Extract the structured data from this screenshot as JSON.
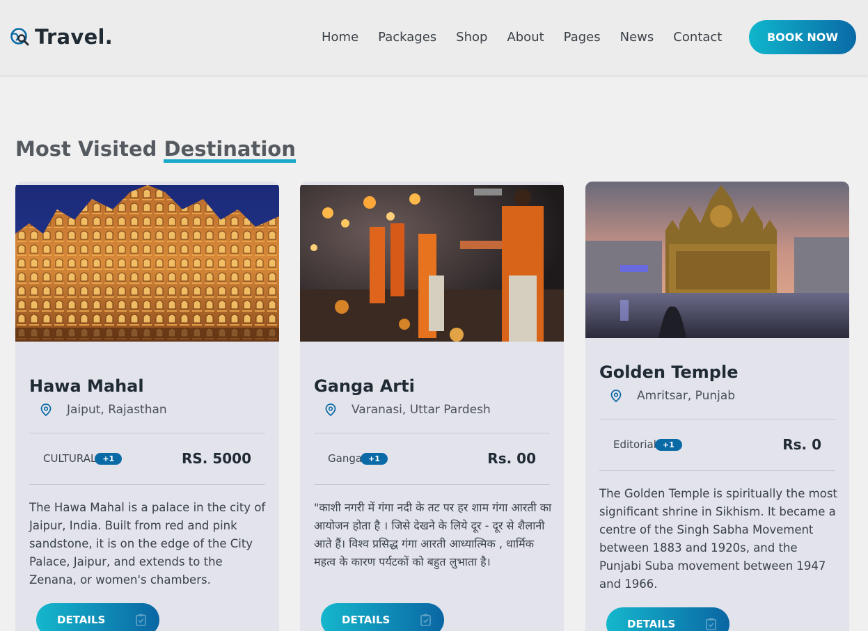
{
  "nav": {
    "logo_text": "Travel.",
    "items": [
      {
        "label": "Home"
      },
      {
        "label": "Packages"
      },
      {
        "label": "Shop"
      },
      {
        "label": "About"
      },
      {
        "label": "Pages"
      },
      {
        "label": "News"
      },
      {
        "label": "Contact"
      }
    ],
    "cta_label": "BOOK NOW"
  },
  "section": {
    "title_prefix": "Most Visited",
    "title_highlight": "Destination"
  },
  "cards": [
    {
      "title": "Hawa Mahal",
      "location": "Jaiput, Rajasthan",
      "category": "CULTURAL",
      "badge": "+1",
      "price": "RS. 5000",
      "description": "The Hawa Mahal is a palace in the city of Jaipur, India. Built from red and pink sandstone, it is on the edge of the City Palace, Jaipur, and extends to the Zenana, or women's chambers.",
      "button": "DETAILS"
    },
    {
      "title": "Ganga Arti",
      "location": "Varanasi, Uttar Pardesh",
      "category": "Ganga",
      "badge": "+1",
      "price": "Rs. 00",
      "description": "\"काशी नगरी में गंगा नदी के तट पर हर शाम गंगा आरती का आयोजन होता है । जिसे देखने के लिये दूर - दूर से शैलानी आते हैं। विश्व प्रसिद्ध गंगा आरती आध्यात्मिक , धार्मिक महत्व के कारण पर्यटकों को बहुत लुभाता है।",
      "button": "DETAILS"
    },
    {
      "title": "Golden Temple",
      "location": "Amritsar, Punjab",
      "category": "Editorial",
      "badge": "+1",
      "price": "Rs. 0",
      "description": "The Golden Temple is spiritually the most significant shrine in Sikhism. It became a centre of the Singh Sabha Movement between 1883 and 1920s, and the Punjabi Suba movement between 1947 and 1966.",
      "button": "DETAILS"
    }
  ],
  "colors": {
    "accent": "#17a9c7",
    "primary_dark": "#0a6aa6",
    "card_bg": "#e2e3eb"
  }
}
